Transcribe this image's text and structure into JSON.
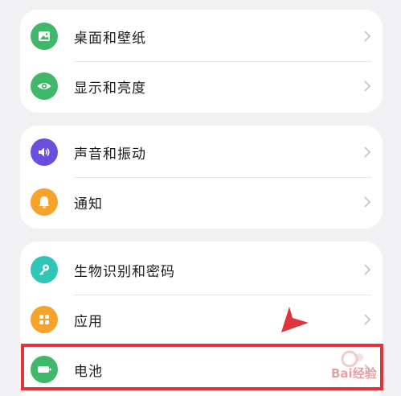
{
  "groups": [
    {
      "items": [
        {
          "label": "桌面和壁纸",
          "icon": "wallpaper-icon",
          "color": "#3fb86a"
        },
        {
          "label": "显示和亮度",
          "icon": "eye-icon",
          "color": "#3fb86a"
        }
      ]
    },
    {
      "items": [
        {
          "label": "声音和振动",
          "icon": "volume-icon",
          "color": "#6a4ee0"
        },
        {
          "label": "通知",
          "icon": "bell-icon",
          "color": "#f5a32b"
        }
      ]
    },
    {
      "items": [
        {
          "label": "生物识别和密码",
          "icon": "key-icon",
          "color": "#2fc6b8"
        },
        {
          "label": "应用",
          "icon": "apps-icon",
          "color": "#f5a32b"
        },
        {
          "label": "电池",
          "icon": "battery-icon",
          "color": "#3fb86a"
        }
      ]
    }
  ],
  "annotation": {
    "highlight_color": "#e0353a",
    "highlighted_item": "电池"
  },
  "watermark": {
    "text": "Bai经验"
  }
}
